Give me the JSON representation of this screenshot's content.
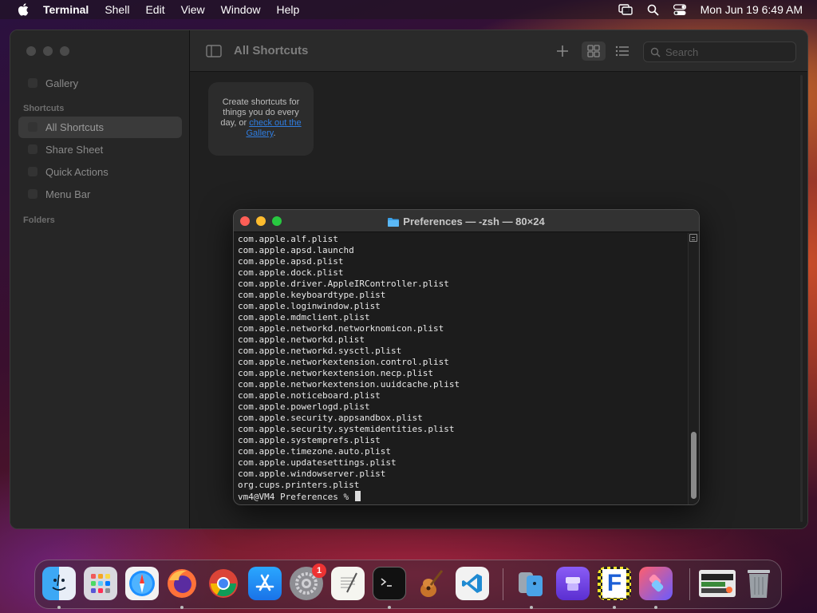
{
  "menubar": {
    "app_name": "Terminal",
    "items": [
      "Shell",
      "Edit",
      "View",
      "Window",
      "Help"
    ],
    "clock": "Mon Jun 19  6:49 AM"
  },
  "shortcuts": {
    "sidebar": {
      "gallery": "Gallery",
      "section_shortcuts": "Shortcuts",
      "items": [
        "All Shortcuts",
        "Share Sheet",
        "Quick Actions",
        "Menu Bar"
      ],
      "section_folders": "Folders"
    },
    "toolbar": {
      "title": "All Shortcuts",
      "search_placeholder": "Search"
    },
    "empty_card": {
      "text": "Create shortcuts for things you do every day, or",
      "link": "check out the Gallery",
      "suffix": "."
    }
  },
  "terminal": {
    "title": "Preferences — -zsh — 80×24",
    "lines": [
      "com.apple.alf.plist",
      "com.apple.apsd.launchd",
      "com.apple.apsd.plist",
      "com.apple.dock.plist",
      "com.apple.driver.AppleIRController.plist",
      "com.apple.keyboardtype.plist",
      "com.apple.loginwindow.plist",
      "com.apple.mdmclient.plist",
      "com.apple.networkd.networknomicon.plist",
      "com.apple.networkd.plist",
      "com.apple.networkd.sysctl.plist",
      "com.apple.networkextension.control.plist",
      "com.apple.networkextension.necp.plist",
      "com.apple.networkextension.uuidcache.plist",
      "com.apple.noticeboard.plist",
      "com.apple.powerlogd.plist",
      "com.apple.security.appsandbox.plist",
      "com.apple.security.systemidentities.plist",
      "com.apple.systemprefs.plist",
      "com.apple.timezone.auto.plist",
      "com.apple.updatesettings.plist",
      "com.apple.windowserver.plist",
      "org.cups.printers.plist"
    ],
    "prompt": "vm4@VM4 Preferences % "
  },
  "dock": {
    "apps": [
      "Finder",
      "Launchpad",
      "Safari",
      "Firefox",
      "Chrome",
      "App Store",
      "System Settings",
      "TextEdit",
      "Terminal",
      "GarageBand",
      "Visual Studio Code",
      "Migration Assistant",
      "Apple Configurator",
      "F App",
      "Shortcuts",
      "Screenshot",
      "Trash"
    ],
    "system_settings_badge": "1"
  },
  "colors": {
    "accent_link": "#2f7de1",
    "close": "#ff5f57",
    "minimize": "#febc2e",
    "zoom": "#28c840"
  }
}
